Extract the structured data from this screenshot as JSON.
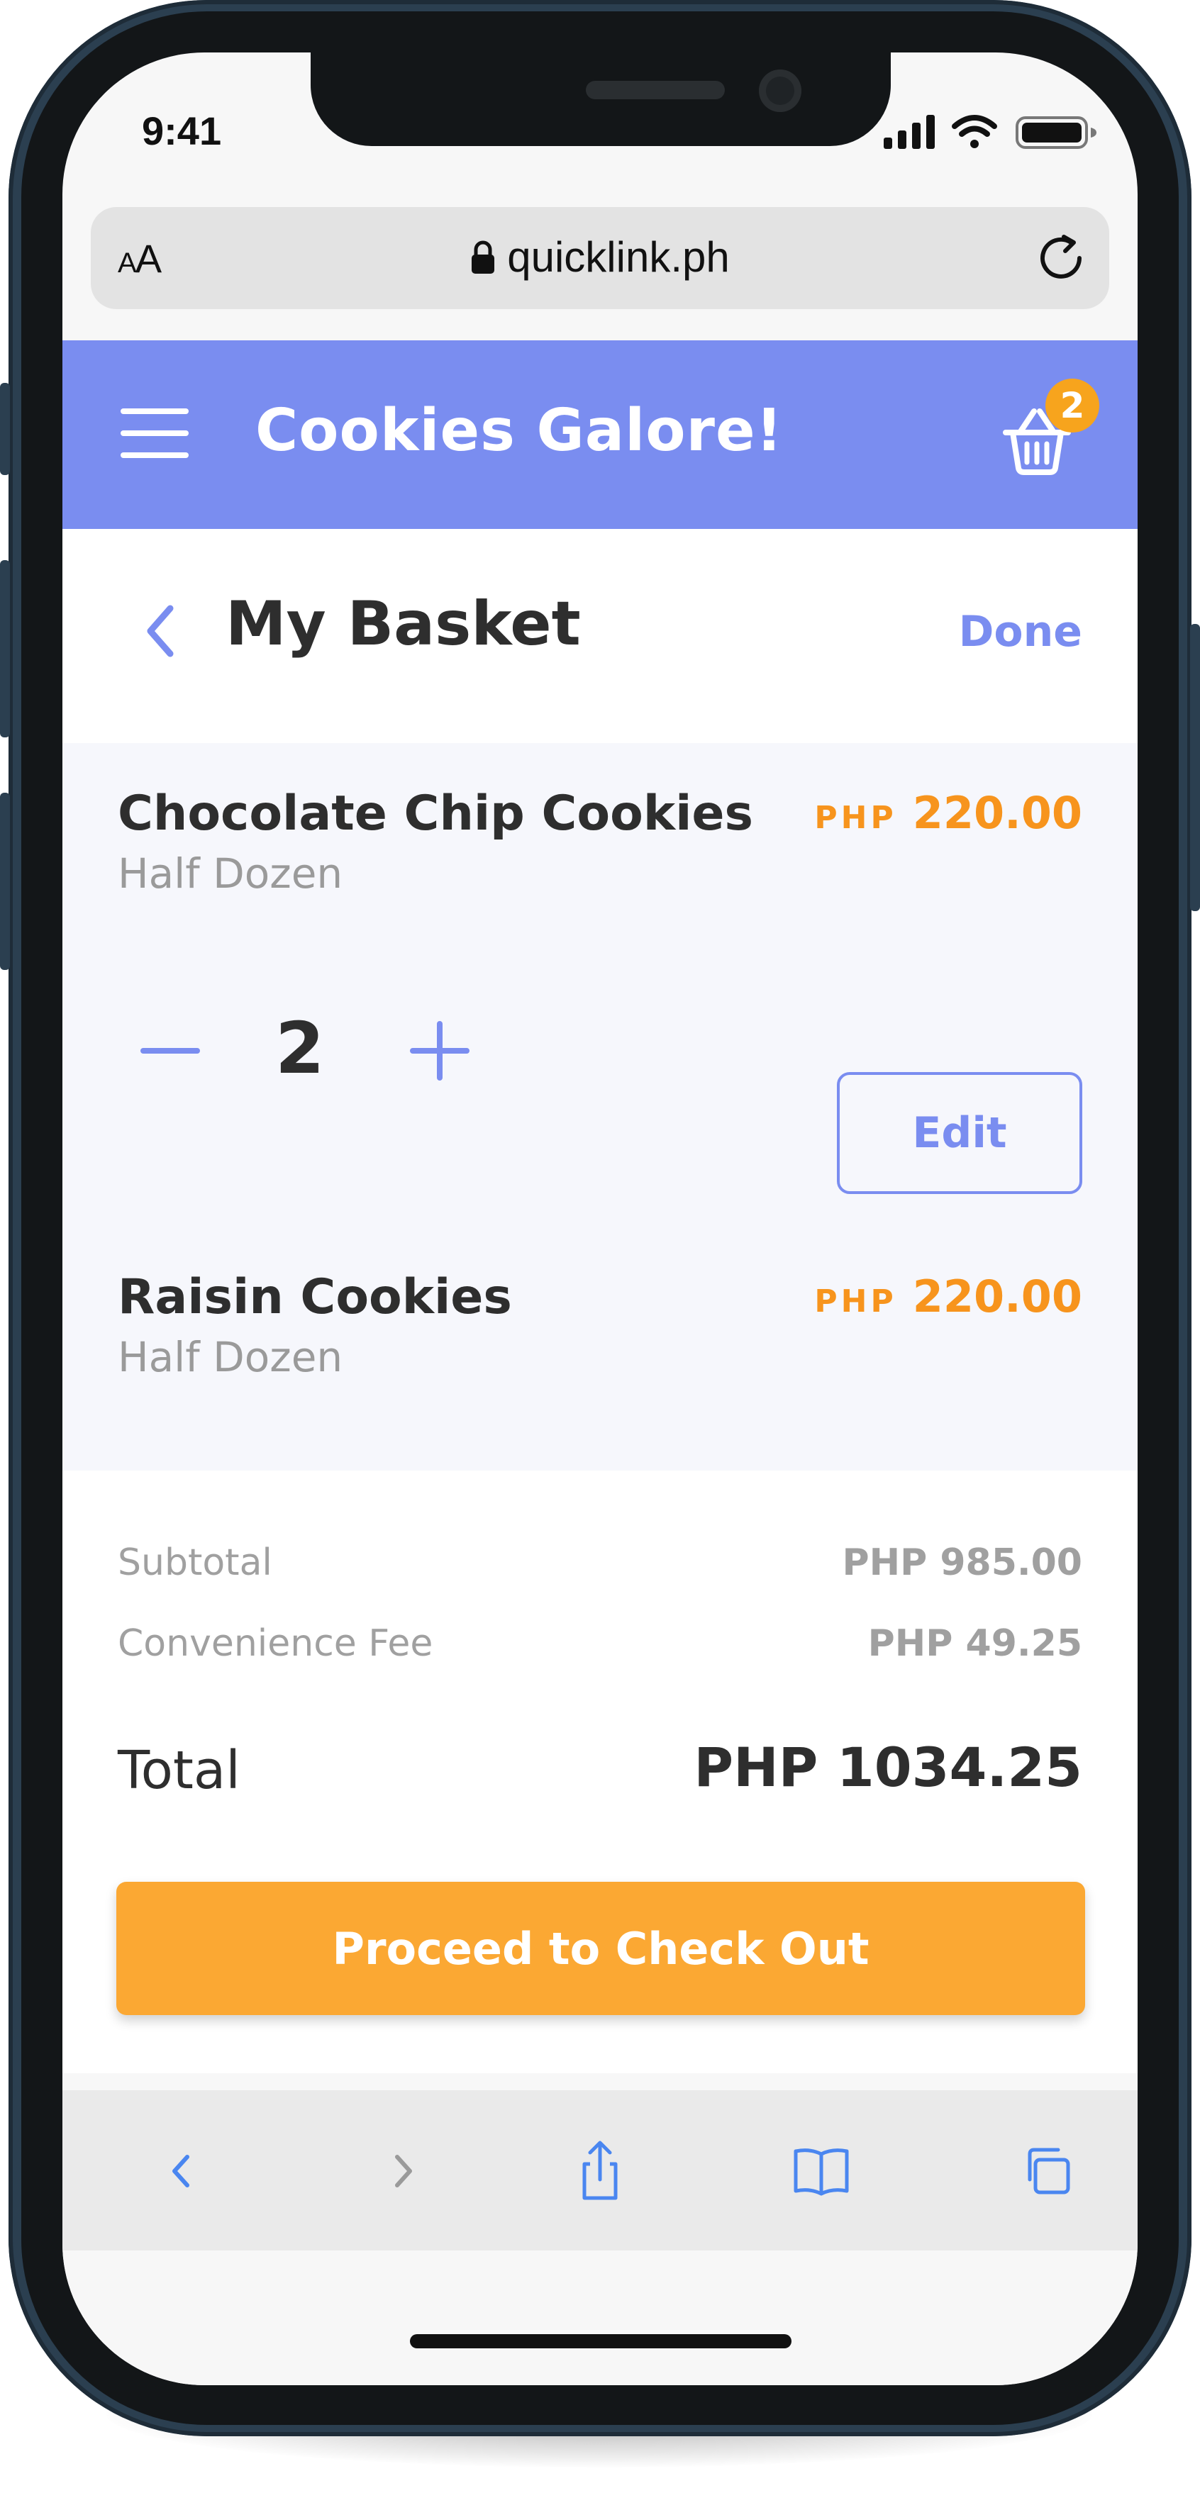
{
  "status_bar": {
    "time": "9:41"
  },
  "browser": {
    "text_size_label": {
      "small": "A",
      "large": "A"
    },
    "url": "quicklink.ph",
    "icons": [
      "lock-icon",
      "reload-icon",
      "back-icon",
      "forward-icon",
      "share-icon",
      "bookmarks-icon",
      "tabs-icon"
    ]
  },
  "header": {
    "title": "Cookies Galore!",
    "cart_count": "2",
    "brand_color": "#7a8df0"
  },
  "page": {
    "title": "My Basket",
    "done_label": "Done"
  },
  "items": [
    {
      "name": "Chocolate Chip Cookies",
      "variant": "Half Dozen",
      "currency": "PHP",
      "price": "220.00",
      "quantity": "2",
      "edit_label": "Edit"
    },
    {
      "name": "Raisin Cookies",
      "variant": "Half Dozen",
      "currency": "PHP",
      "price": "220.00"
    }
  ],
  "summary": {
    "subtotal_label": "Subtotal",
    "subtotal_value": "PHP 985.00",
    "fee_label": "Convenience Fee",
    "fee_value": "PHP 49.25",
    "total_label": "Total",
    "total_value": "PHP 1034.25"
  },
  "checkout": {
    "label": "Proceed to Check Out",
    "color": "#fba833"
  },
  "colors": {
    "accent_orange": "#f7941d",
    "text_dark": "#2e2e2e",
    "text_muted": "#9a9a9a"
  }
}
